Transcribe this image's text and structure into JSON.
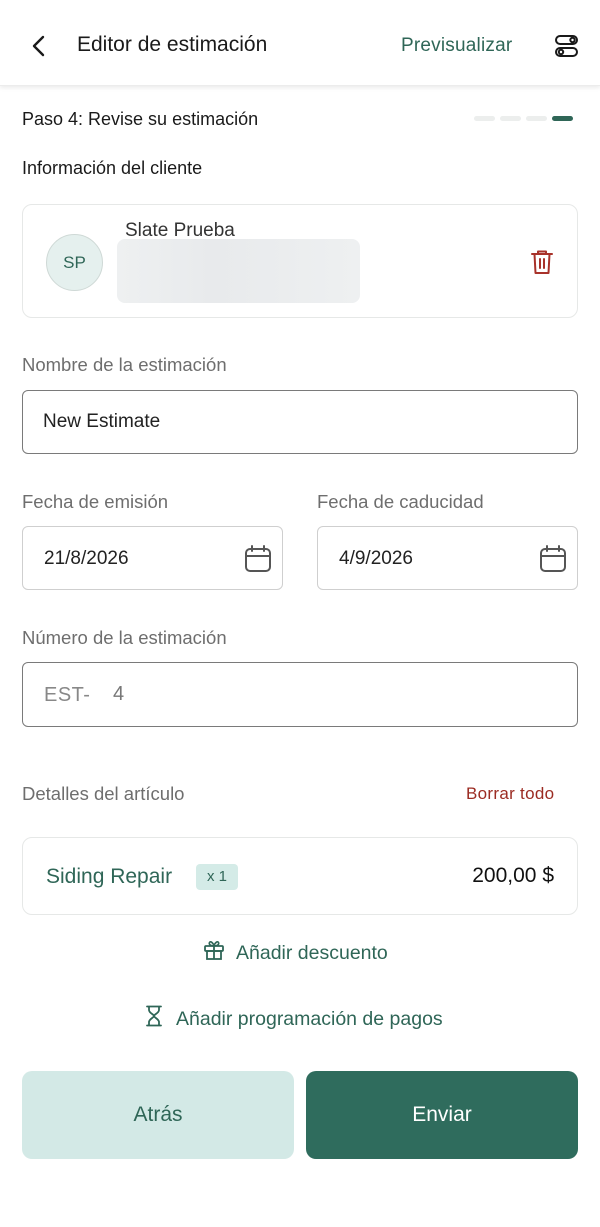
{
  "header": {
    "title": "Editor de estimación",
    "preview_label": "Previsualizar",
    "back_icon": "chevron-left-icon",
    "settings_icon": "settings-toggle-icon"
  },
  "step": {
    "label": "Paso 4: Revise su estimación",
    "current": 4,
    "total": 4
  },
  "client_section": {
    "title": "Información del cliente",
    "client": {
      "initials": "SP",
      "name": "Slate Prueba"
    },
    "delete_icon": "trash-icon"
  },
  "estimate_name": {
    "label": "Nombre de la estimación",
    "value": "New Estimate"
  },
  "dates": {
    "issue_label": "Fecha de emisión",
    "issue_value": "21/8/2026",
    "expiry_label": "Fecha de caducidad",
    "expiry_value": "4/9/2026",
    "calendar_icon": "calendar-icon"
  },
  "estimate_number": {
    "label": "Número de la estimación",
    "prefix": "EST-",
    "value": "4"
  },
  "items": {
    "title": "Detalles del artículo",
    "clear_all_label": "Borrar todo",
    "list": [
      {
        "name": "Siding Repair",
        "quantity": "x 1",
        "price": "200,00 $"
      }
    ]
  },
  "actions": {
    "add_discount": "Añadir descuento",
    "add_payment_schedule": "Añadir programación de pagos",
    "discount_icon": "gift-icon",
    "schedule_icon": "hourglass-icon"
  },
  "buttons": {
    "back": "Atrás",
    "send": "Enviar"
  },
  "colors": {
    "brand": "#2f6657",
    "brand_light": "#d3e9e6",
    "danger": "#9b2b22"
  }
}
